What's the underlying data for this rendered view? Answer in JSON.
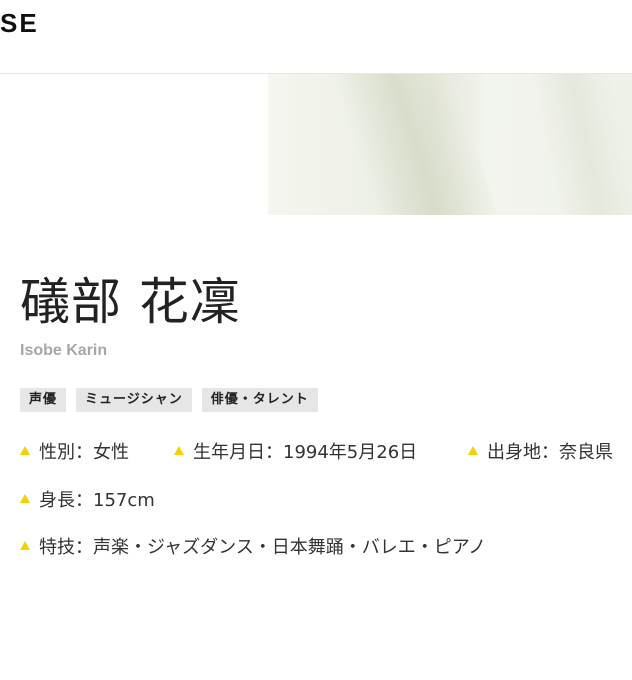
{
  "header": {
    "brand_text": "SE"
  },
  "profile": {
    "name_jp": "礒部 花凜",
    "name_en": "Isobe Karin",
    "tags": [
      "声優",
      "ミュージシャン",
      "俳優・タレント"
    ],
    "info": {
      "gender": "性別：女性",
      "birthday": "生年月日：1994年5月26日",
      "birthplace": "出身地：奈良県",
      "height": "身長：157cm",
      "skills": "特技：声楽・ジャズダンス・日本舞踊・バレエ・ピアノ"
    }
  },
  "colors": {
    "bullet": "#f2d400",
    "tag_bg": "#e6e6e6",
    "subtitle": "#a7a7a7"
  },
  "icons": {
    "bullet": "triangle-bullet-icon"
  }
}
